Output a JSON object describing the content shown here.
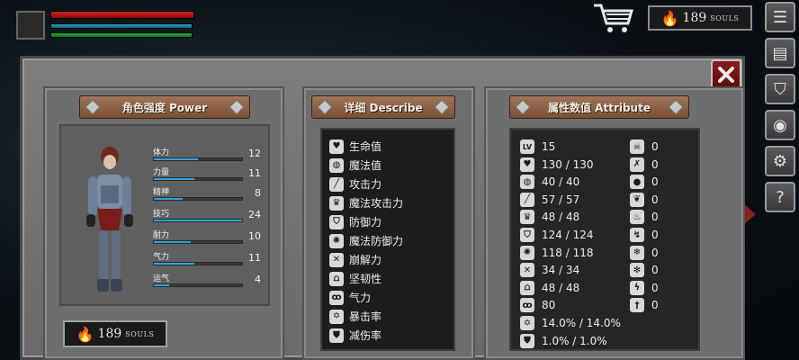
{
  "hud": {
    "currency": {
      "value": "189",
      "unit": "SOULS"
    },
    "hp_fraction": 1.0,
    "mp_fraction": 1.0,
    "stamina_fraction": 1.0
  },
  "side_menu": [
    "list-icon",
    "scroll-icon",
    "armor-icon",
    "shield-icon",
    "gear-icon",
    "question-icon"
  ],
  "panels": {
    "power": {
      "title": "角色强度 Power",
      "stats": [
        {
          "name": "体力",
          "value": "12",
          "fraction": 0.5
        },
        {
          "name": "力量",
          "value": "11",
          "fraction": 0.46
        },
        {
          "name": "精神",
          "value": "8",
          "fraction": 0.33
        },
        {
          "name": "技巧",
          "value": "24",
          "fraction": 1.0
        },
        {
          "name": "耐力",
          "value": "10",
          "fraction": 0.42
        },
        {
          "name": "气力",
          "value": "11",
          "fraction": 0.46
        },
        {
          "name": "运气",
          "value": "4",
          "fraction": 0.17
        }
      ],
      "souls": {
        "value": "189",
        "unit": "SOULS"
      }
    },
    "describe": {
      "title": "详细 Describe",
      "items": [
        {
          "icon": "heart-icon",
          "label": "生命值"
        },
        {
          "icon": "brain-icon",
          "label": "魔法值"
        },
        {
          "icon": "sword-icon",
          "label": "攻击力"
        },
        {
          "icon": "crown-icon",
          "label": "魔法攻击力"
        },
        {
          "icon": "shield-icon",
          "label": "防御力"
        },
        {
          "icon": "magic-shield-icon",
          "label": "魔法防御力"
        },
        {
          "icon": "broken-sword-icon",
          "label": "崩解力"
        },
        {
          "icon": "helmet-icon",
          "label": "坚韧性"
        },
        {
          "icon": "lungs-icon",
          "label": "气力"
        },
        {
          "icon": "burst-icon",
          "label": "暴击率"
        },
        {
          "icon": "armor-icon",
          "label": "减伤率"
        }
      ]
    },
    "attribute": {
      "title": "属性数值 Attribute",
      "left": [
        {
          "icon": "lv-icon",
          "icon_text": "LV",
          "value": "15"
        },
        {
          "icon": "heart-icon",
          "value": "130 / 130"
        },
        {
          "icon": "brain-icon",
          "value": "40 / 40"
        },
        {
          "icon": "sword-icon",
          "value": "57 / 57"
        },
        {
          "icon": "crown-icon",
          "value": "48 / 48"
        },
        {
          "icon": "shield-icon",
          "value": "124 / 124"
        },
        {
          "icon": "magic-shield-icon",
          "value": "118 / 118"
        },
        {
          "icon": "broken-sword-icon",
          "value": "34 / 34"
        },
        {
          "icon": "helmet-icon",
          "value": "48 / 48"
        },
        {
          "icon": "lungs-icon",
          "value": "80"
        },
        {
          "icon": "burst-icon",
          "value": "14.0% / 14.0%"
        },
        {
          "icon": "armor-icon",
          "value": "1.0% / 1.0%"
        }
      ],
      "right": [
        {
          "icon": "skull-icon",
          "value": "0"
        },
        {
          "icon": "bone-icon",
          "value": "0"
        },
        {
          "icon": "drop-icon",
          "value": "0"
        },
        {
          "icon": "leaf-icon",
          "value": "0"
        },
        {
          "icon": "fire-icon",
          "value": "0"
        },
        {
          "icon": "lightning-icon",
          "value": "0"
        },
        {
          "icon": "frost-icon",
          "value": "0"
        },
        {
          "icon": "snowflake-icon",
          "value": "0"
        },
        {
          "icon": "bolt-icon",
          "value": "0"
        },
        {
          "icon": "dagger-icon",
          "value": "0"
        }
      ]
    }
  }
}
